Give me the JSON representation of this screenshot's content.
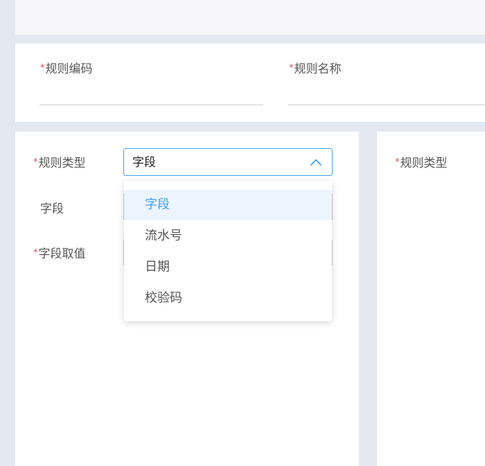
{
  "header_form": {
    "rule_code_label": "规则编码",
    "rule_name_label": "规则名称",
    "required_mark": "*"
  },
  "left_form": {
    "rule_type_label": "规则类型",
    "field_label": "字段",
    "field_value_label": "字段取值",
    "rule_type_selected": "字段",
    "dropdown_options": [
      "字段",
      "流水号",
      "日期",
      "校验码"
    ],
    "selected_index": 0
  },
  "right_form": {
    "rule_type_label": "规则类型"
  },
  "colors": {
    "accent": "#409eff",
    "required": "#e5484d",
    "background": "#e4e8f1",
    "selected_option_bg": "#ecf4ff"
  }
}
